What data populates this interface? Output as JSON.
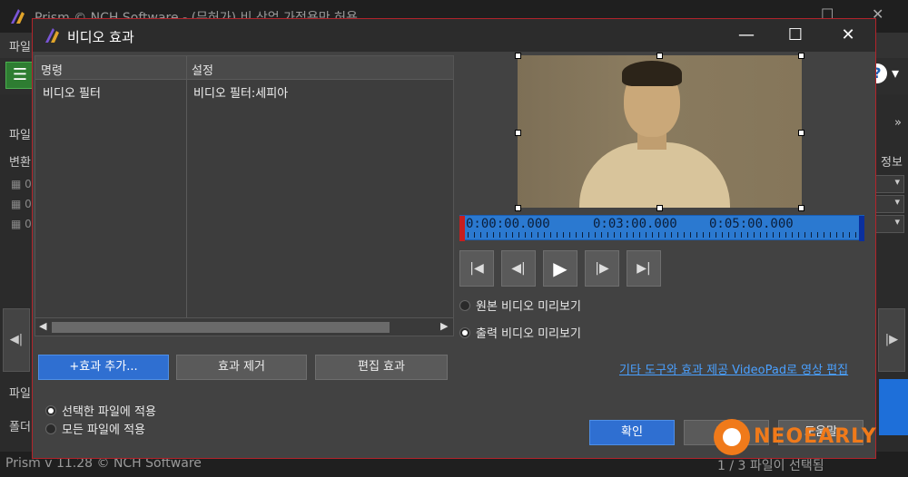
{
  "background_app": {
    "title": "Prism © NCH Software - (무허가) 비 상업 가정용만 허용",
    "menu_first": "파일",
    "side_labels": [
      "파일",
      "변환",
      "파일",
      "폴더"
    ],
    "file_rows": [
      "0",
      "0",
      "0"
    ],
    "info_label": "정보",
    "status_left": "Prism v 11.28 © NCH Software",
    "status_right": "1 / 3 파일이 선택됨"
  },
  "dialog": {
    "title": "비디오 효과",
    "table": {
      "headers": [
        "명령",
        "설정"
      ],
      "rows": [
        {
          "command": "비디오 필터",
          "setting": "비디오 필터:세피아"
        }
      ]
    },
    "buttons": {
      "add_effect": "+효과 추가...",
      "remove_effect": "효과 제거",
      "edit_effect": "편집 효과",
      "ok": "확인",
      "cancel": "취소",
      "help": "도움말"
    },
    "apply_options": [
      {
        "label": "선택한 파일에 적용",
        "selected": true
      },
      {
        "label": "모든 파일에 적용",
        "selected": false
      }
    ],
    "preview_options": [
      {
        "label": "원본 비디오 미리보기",
        "selected": false
      },
      {
        "label": "출력 비디오 미리보기",
        "selected": true
      }
    ],
    "timeline": {
      "marks": [
        "0:00:00.000",
        "0:03:00.000",
        "0:05:00.000"
      ]
    },
    "link_text": "기타 도구와 효과 제공 VideoPad로 영상 편집"
  },
  "watermark": "NEOEARLY",
  "colors": {
    "dialog_border": "#b2242b",
    "primary_button": "#2f6fd1",
    "timeline": "#2b79d0",
    "link": "#4aa0ff",
    "watermark": "#f07a1a"
  },
  "icons": {
    "transport": [
      "skip-start-icon",
      "step-back-icon",
      "play-icon",
      "step-forward-icon",
      "skip-end-icon"
    ]
  }
}
